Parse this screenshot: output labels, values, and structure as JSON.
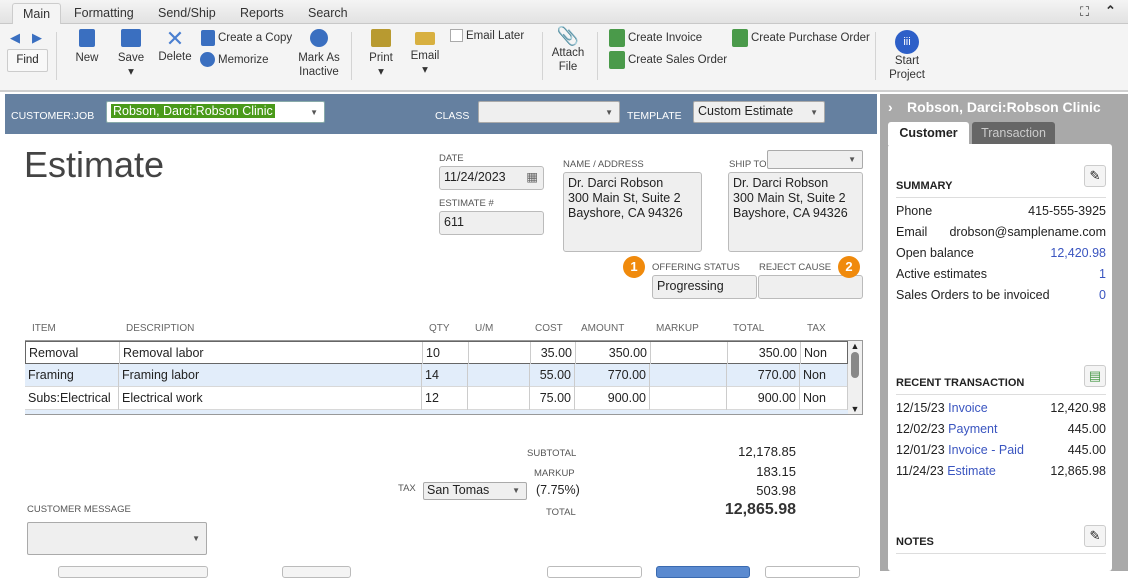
{
  "tabs": [
    "Main",
    "Formatting",
    "Send/Ship",
    "Reports",
    "Search"
  ],
  "ribbon": {
    "find": "Find",
    "new": "New",
    "save": "Save",
    "delete": "Delete",
    "create_copy": "Create a Copy",
    "memorize": "Memorize",
    "mark_inactive_1": "Mark As",
    "mark_inactive_2": "Inactive",
    "print": "Print",
    "email": "Email",
    "email_later": "Email Later",
    "attach_1": "Attach",
    "attach_2": "File",
    "create_invoice": "Create Invoice",
    "create_sales_order": "Create Sales Order",
    "create_po": "Create Purchase Order",
    "start_project_1": "Start",
    "start_project_2": "Project"
  },
  "header": {
    "customer_job_label": "CUSTOMER:JOB",
    "customer_job": "Robson, Darci:Robson Clinic",
    "class_label": "CLASS",
    "class": "",
    "template_label": "TEMPLATE",
    "template": "Custom Estimate"
  },
  "form": {
    "title": "Estimate",
    "date_label": "DATE",
    "date": "11/24/2023",
    "estimate_no_label": "ESTIMATE #",
    "estimate_no": "611",
    "name_address_label": "NAME / ADDRESS",
    "name_address": [
      "Dr. Darci Robson",
      "300 Main St, Suite 2",
      "Bayshore, CA 94326"
    ],
    "ship_to_label": "SHIP TO",
    "ship_to": [
      "Dr. Darci Robson",
      "300 Main St, Suite 2",
      "Bayshore, CA 94326"
    ],
    "offering_status_label": "OFFERING STATUS",
    "offering_status": "Progressing",
    "reject_cause_label": "REJECT CAUSE",
    "reject_cause": "",
    "badge1": "1",
    "badge2": "2"
  },
  "table": {
    "columns": [
      "ITEM",
      "DESCRIPTION",
      "QTY",
      "U/M",
      "COST",
      "AMOUNT",
      "MARKUP",
      "TOTAL",
      "TAX"
    ],
    "rows": [
      {
        "item": "Removal",
        "desc": "Removal labor",
        "qty": "10",
        "um": "",
        "cost": "35.00",
        "amount": "350.00",
        "markup": "",
        "total": "350.00",
        "tax": "Non"
      },
      {
        "item": "Framing",
        "desc": "Framing labor",
        "qty": "14",
        "um": "",
        "cost": "55.00",
        "amount": "770.00",
        "markup": "",
        "total": "770.00",
        "tax": "Non"
      },
      {
        "item": "Subs:Electrical",
        "desc": "Electrical work",
        "qty": "12",
        "um": "",
        "cost": "75.00",
        "amount": "900.00",
        "markup": "",
        "total": "900.00",
        "tax": "Non"
      }
    ]
  },
  "totals": {
    "subtotal_label": "SUBTOTAL",
    "subtotal": "12,178.85",
    "markup_label": "MARKUP",
    "markup": "183.15",
    "tax_label": "TAX",
    "tax_code": "San Tomas",
    "tax_rate": "(7.75%)",
    "tax": "503.98",
    "total_label": "TOTAL",
    "total": "12,865.98",
    "customer_message_label": "CUSTOMER MESSAGE"
  },
  "side": {
    "title": "Robson, Darci:Robson Clinic",
    "tab_customer": "Customer",
    "tab_transaction": "Transaction",
    "summary_label": "SUMMARY",
    "summary": [
      {
        "k": "Phone",
        "v": "415-555-3925"
      },
      {
        "k": "Email",
        "v": "drobson@samplename.com"
      },
      {
        "k": "Open balance",
        "v": "12,420.98"
      },
      {
        "k": "Active estimates",
        "v": "1"
      },
      {
        "k": "Sales Orders to be invoiced",
        "v": "0"
      }
    ],
    "recent_label": "RECENT TRANSACTION",
    "recent": [
      {
        "date": "12/15/23",
        "type": "Invoice",
        "extra": "",
        "amount": "12,420.98"
      },
      {
        "date": "12/02/23",
        "type": "Payment",
        "extra": "",
        "amount": "445.00"
      },
      {
        "date": "12/01/23",
        "type": "Invoice",
        "extra": " - Paid",
        "amount": "445.00"
      },
      {
        "date": "11/24/23",
        "type": "Estimate",
        "extra": "",
        "amount": "12,865.98"
      }
    ],
    "notes_label": "NOTES"
  }
}
